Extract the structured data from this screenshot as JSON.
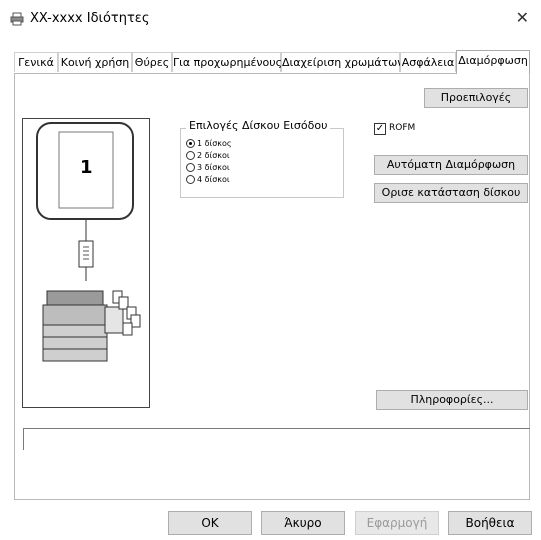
{
  "window": {
    "title": "XX-xxxx Ιδιότητες",
    "close_glyph": "✕",
    "icon": "printer-icon"
  },
  "tabs": [
    {
      "label": "Γενικά"
    },
    {
      "label": "Κοινή χρήση"
    },
    {
      "label": "Θύρες"
    },
    {
      "label": "Για προχωρημένους"
    },
    {
      "label": "Διαχείριση χρωμάτων"
    },
    {
      "label": "Ασφάλεια"
    },
    {
      "label": "Διαμόρφωση",
      "active": true
    }
  ],
  "config": {
    "defaults_button": "Προεπιλογές",
    "preview_page_number": "1",
    "input_disk": {
      "legend": "Επιλογές Δίσκου Εισόδου",
      "options": [
        "1 δίσκος",
        "2 δίσκοι",
        "3 δίσκοι",
        "4 δίσκοι"
      ],
      "selected": "1 δίσκος"
    },
    "rofm_label": "ROFM",
    "rofm_checked": true,
    "auto_config_button": "Αυτόματη Διαμόρφωση",
    "set_tray_status_button": "Ορισε κατάσταση δίσκου",
    "info_button": "Πληροφορίες..."
  },
  "footer": {
    "ok": "OK",
    "cancel": "Άκυρο",
    "apply": "Εφαρμογή",
    "help": "Βοήθεια"
  }
}
